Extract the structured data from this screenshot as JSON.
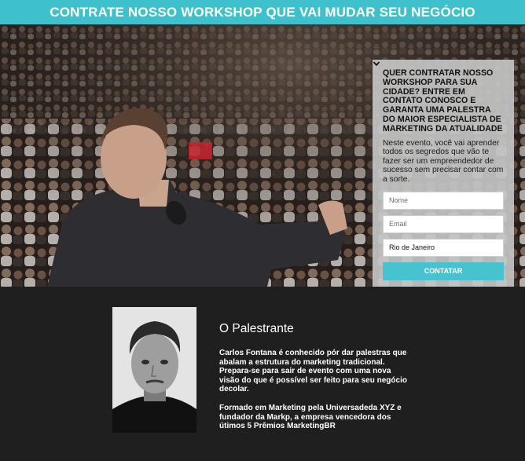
{
  "header": {
    "title": "CONTRATE NOSSO WORKSHOP QUE VAI MUDAR SEU NEGÓCIO",
    "background": "#3fc0cd"
  },
  "hero": {
    "image": "photo of a speaker holding a microphone in front of a large audience"
  },
  "form": {
    "heading": "QUER CONTRATAR NOSSO WORKSHOP PARA SUA CIDADE? ENTRE EM CONTATO CONOSCO E GARANTA UMA PALESTRA DO MAIOR ESPECIALISTA DE MARKETING DA ATUALIDADE",
    "description": "Neste evento, você vai aprender todos os segredos que vão te fazer ser um empreendedor de sucesso sem precisar contar com a sorte.",
    "name_placeholder": "Nome",
    "email_placeholder": "Email",
    "city_selected": "Rio de Janeiro",
    "submit_label": "CONTATAR",
    "accent": "#47c3cf"
  },
  "speaker": {
    "heading": "O Palestrante",
    "bio_1": "Carlos Fontana é conhecido pór dar palestras que abalam a estrutura do marketing tradicional. Prepara-se para sair de evento com uma nova visão do que é possível ser feito para seu negócio decolar.",
    "bio_2": "Formado em Marketing pela Universadeda XYZ e fundador da Markp, a empresa vencedora dos útimos 5 Prêmios MarketingBR"
  }
}
